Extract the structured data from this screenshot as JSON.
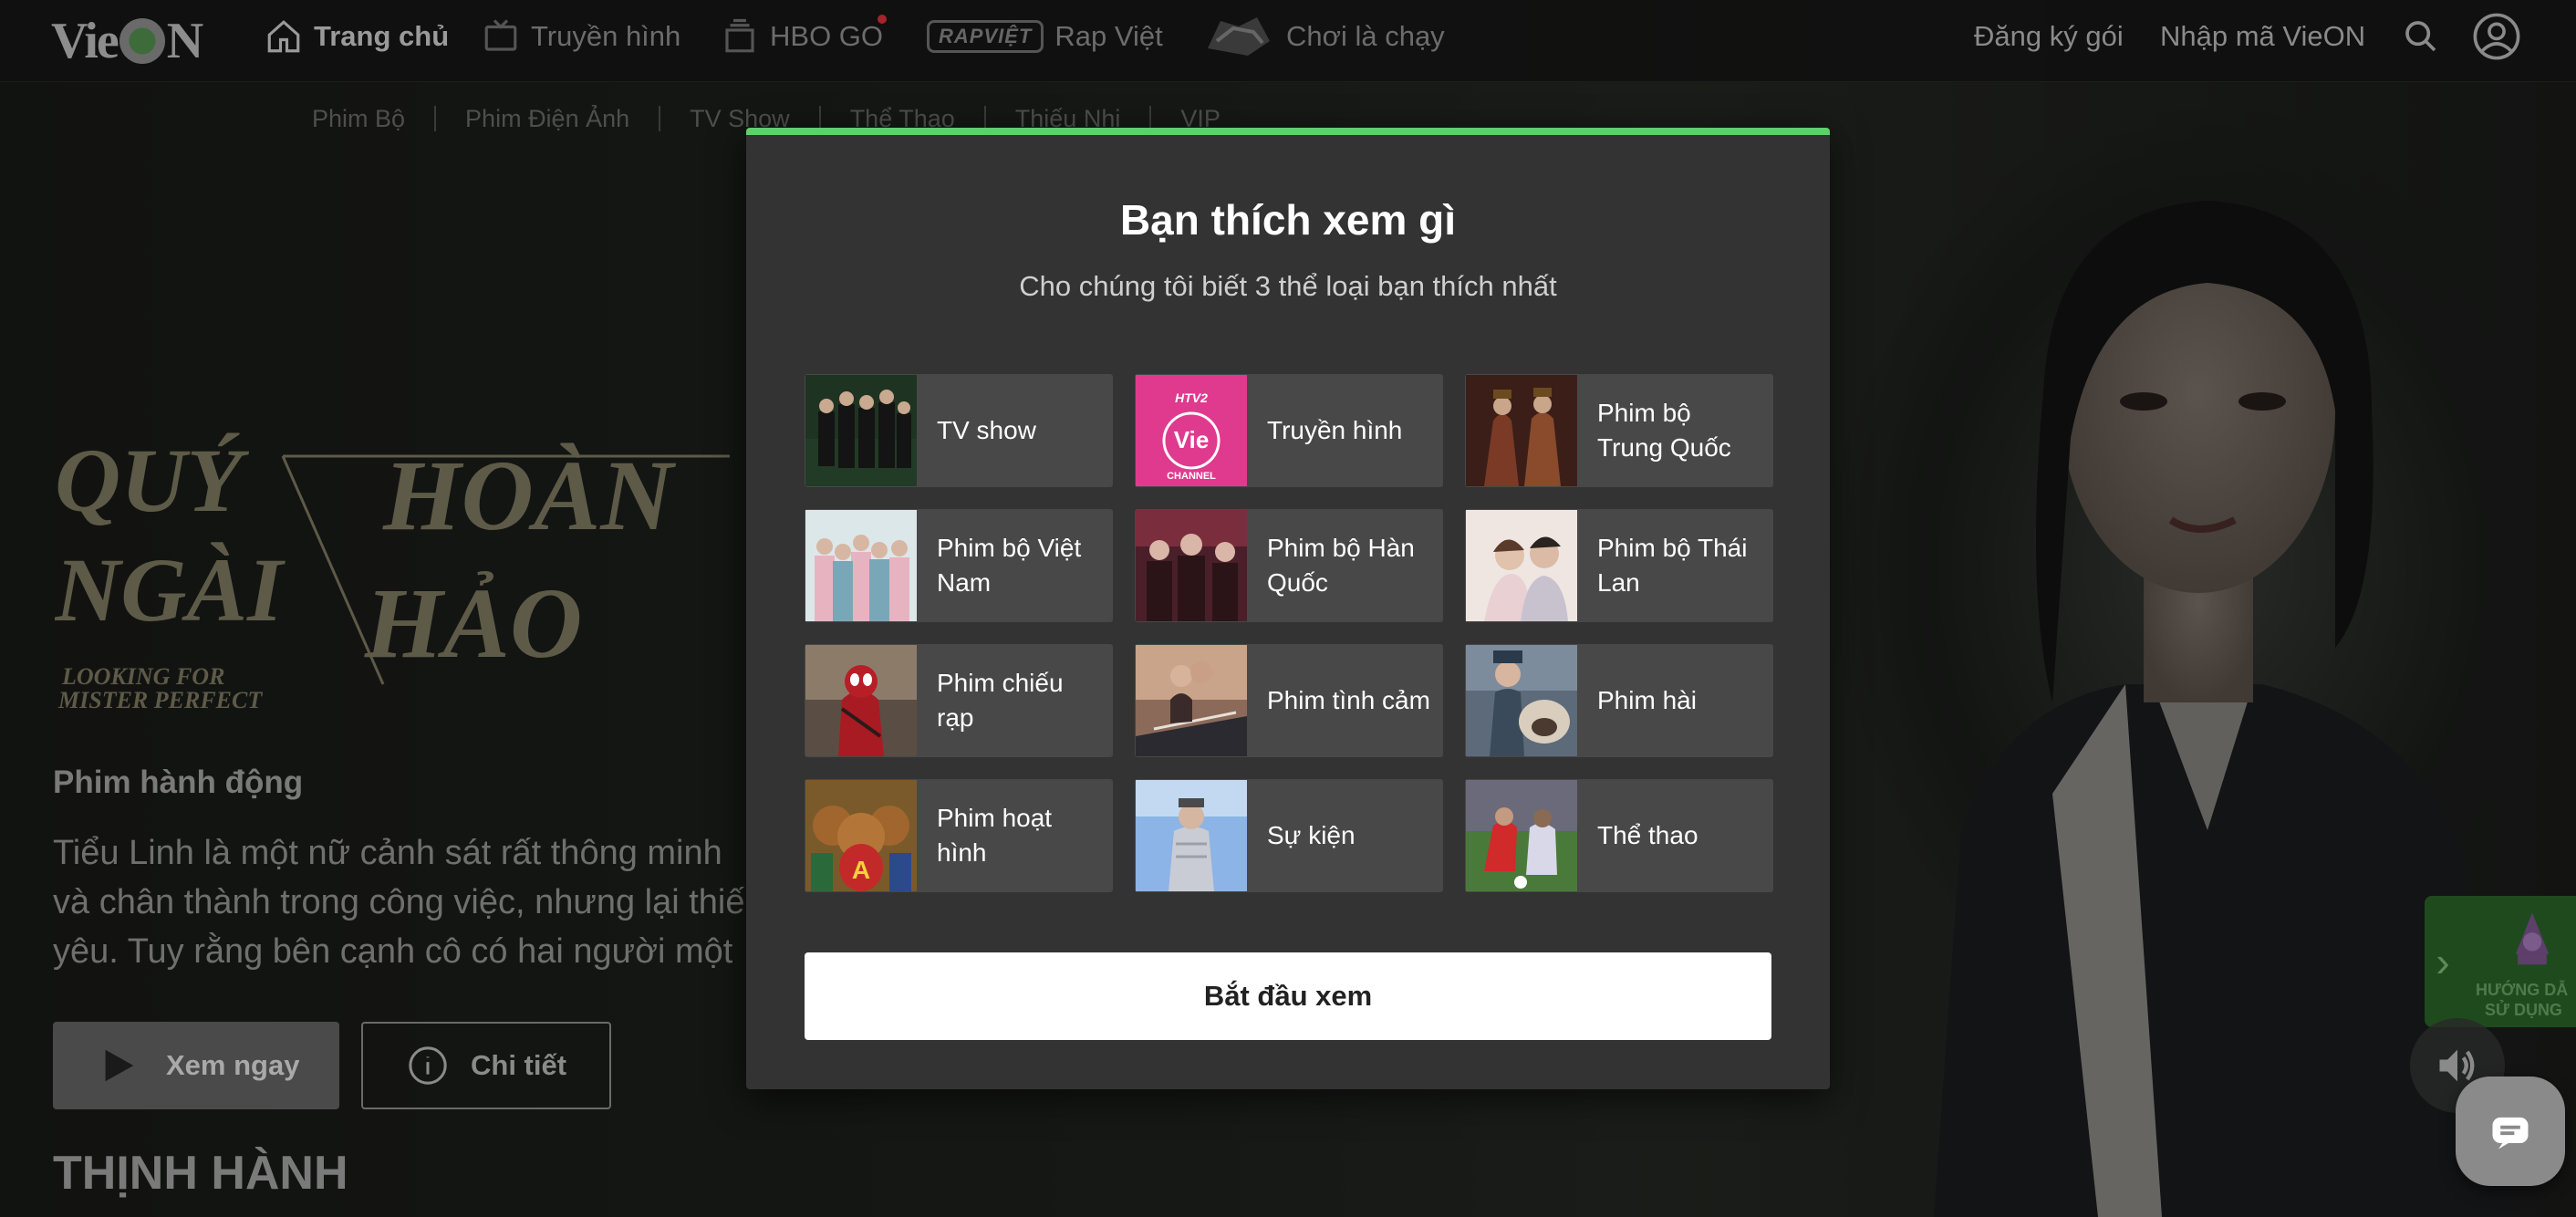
{
  "nav": {
    "logo_text": "VieON",
    "items": [
      {
        "label": "Trang chủ",
        "icon": "home-icon"
      },
      {
        "label": "Truyền hình",
        "icon": "tv-icon"
      },
      {
        "label": "HBO GO",
        "icon": "hbo-icon"
      },
      {
        "label": "Rap Việt",
        "icon": "rap-viet-logo",
        "logo_text": "RAPVIỆT"
      },
      {
        "label": "Chơi là chạy",
        "icon": "choi-la-chay-logo"
      }
    ],
    "register_label": "Đăng ký gói",
    "redeem_label": "Nhập mã VieON"
  },
  "subnav": [
    "Phim Bộ",
    "Phim Điện Ảnh",
    "TV Show",
    "Thể Thao",
    "Thiếu Nhi",
    "VIP"
  ],
  "hero": {
    "title_line1a": "QUÝ",
    "title_line1b": "HOÀN",
    "title_line2a": "NGÀI",
    "title_line2b": "HẢO",
    "title_en1": "LOOKING FOR",
    "title_en2": "MISTER PERFECT",
    "genre": "Phim hành động",
    "desc_lines": [
      "Tiểu Linh là một nữ cảnh sát rất thông minh",
      "và chân thành trong công việc, nhưng lại thiế",
      "yêu. Tuy rằng bên cạnh cô có hai người một"
    ],
    "play_label": "Xem ngay",
    "detail_label": "Chi tiết",
    "section_heading": "THỊNH HÀNH"
  },
  "guide": {
    "line1": "HƯỚNG DẪ",
    "line2": "SỬ DỤNG"
  },
  "modal": {
    "accent_color": "#5dd06a",
    "title": "Bạn thích xem gì",
    "subtitle": "Cho chúng tôi biết 3 thể loại bạn thích nhất",
    "categories": [
      {
        "label": "TV show"
      },
      {
        "label": "Truyền hình",
        "thumb_top": "HTV2",
        "thumb_brand": "Vie",
        "thumb_sub": "CHANNEL"
      },
      {
        "label": "Phim bộ Trung Quốc"
      },
      {
        "label": "Phim bộ Việt Nam"
      },
      {
        "label": "Phim bộ Hàn Quốc"
      },
      {
        "label": "Phim bộ Thái Lan"
      },
      {
        "label": "Phim chiếu rạp"
      },
      {
        "label": "Phim tình cảm"
      },
      {
        "label": "Phim hài"
      },
      {
        "label": "Phim hoạt hình"
      },
      {
        "label": "Sự kiện"
      },
      {
        "label": "Thể thao"
      }
    ],
    "start_label": "Bắt đầu xem"
  }
}
